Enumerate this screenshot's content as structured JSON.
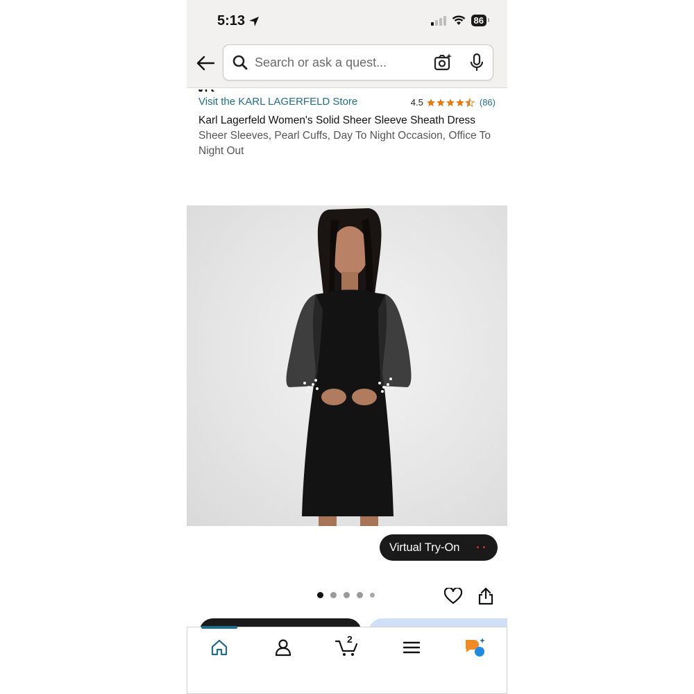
{
  "status": {
    "time": "5:13",
    "battery": "86"
  },
  "search": {
    "placeholder": "Search or ask a quest..."
  },
  "product": {
    "store_link": "Visit the KARL LAGERFELD Store",
    "rating": "4.5",
    "rating_value": 4.5,
    "rating_count": "(86)",
    "title": "Karl Lagerfeld Women's Solid Sheer Sleeve Sheath Dress",
    "subtitle": "Sheer Sleeves, Pearl Cuffs, Day To Night Occasion, Office To Night Out"
  },
  "image": {
    "pager_total": 5,
    "pager_active": 1
  },
  "buttons": {
    "virtual_try_on": "Virtual Try-On"
  },
  "nav": {
    "cart_count": "2"
  },
  "colors": {
    "link": "#1f6e8c",
    "star": "#e47911",
    "header_bg": "#f2f1ef",
    "dark_pill": "#1a1a1a"
  },
  "icons": {
    "back": "back-arrow-icon",
    "search": "search-icon",
    "camera": "camera-sparkle-icon",
    "mic": "microphone-icon",
    "heart": "heart-icon",
    "share": "share-icon",
    "home": "home-icon",
    "account": "user-icon",
    "cart": "cart-icon",
    "menu": "menu-icon",
    "rufus": "rufus-assistant-icon"
  }
}
